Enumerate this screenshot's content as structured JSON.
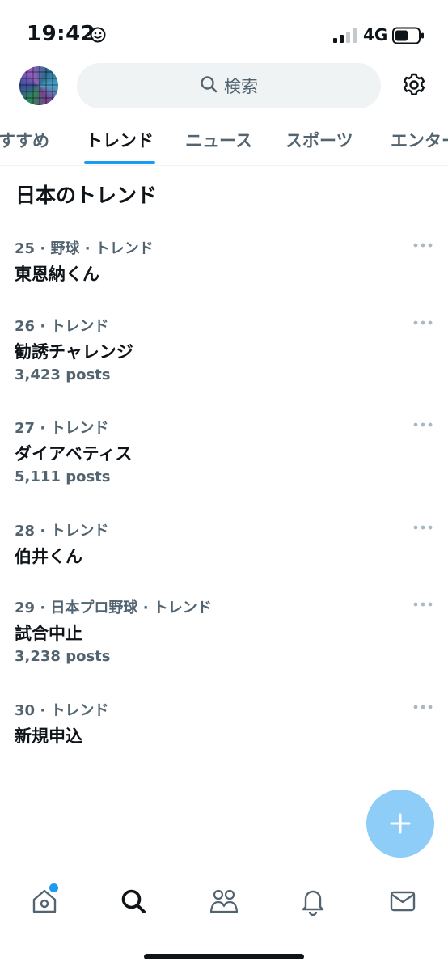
{
  "status_bar": {
    "time": "19:42",
    "network": "4G"
  },
  "header": {
    "search_placeholder": "検索"
  },
  "tabs": [
    {
      "label": "すすめ",
      "active": false
    },
    {
      "label": "トレンド",
      "active": true
    },
    {
      "label": "ニュース",
      "active": false
    },
    {
      "label": "スポーツ",
      "active": false
    },
    {
      "label": "エンター",
      "active": false
    }
  ],
  "section": {
    "title": "日本のトレンド"
  },
  "trends": [
    {
      "rank": "25",
      "category": "野球 · トレンド",
      "name": "東恩納くん",
      "count": ""
    },
    {
      "rank": "26",
      "category": "トレンド",
      "name": "勧誘チャレンジ",
      "count": "3,423 posts"
    },
    {
      "rank": "27",
      "category": "トレンド",
      "name": "ダイアベティス",
      "count": "5,111 posts"
    },
    {
      "rank": "28",
      "category": "トレンド",
      "name": "伯井くん",
      "count": ""
    },
    {
      "rank": "29",
      "category": "日本プロ野球 · トレンド",
      "name": "試合中止",
      "count": "3,238 posts"
    },
    {
      "rank": "30",
      "category": "トレンド",
      "name": "新規申込",
      "count": ""
    }
  ],
  "bottom_nav": {
    "items": [
      "home-icon",
      "search-icon",
      "communities-icon",
      "notifications-icon",
      "messages-icon"
    ],
    "home_has_notification_dot": true
  },
  "colors": {
    "accent": "#1d9bf0",
    "fab": "#8ecdf8",
    "secondary_text": "#536471",
    "search_bg": "#eff3f4"
  }
}
